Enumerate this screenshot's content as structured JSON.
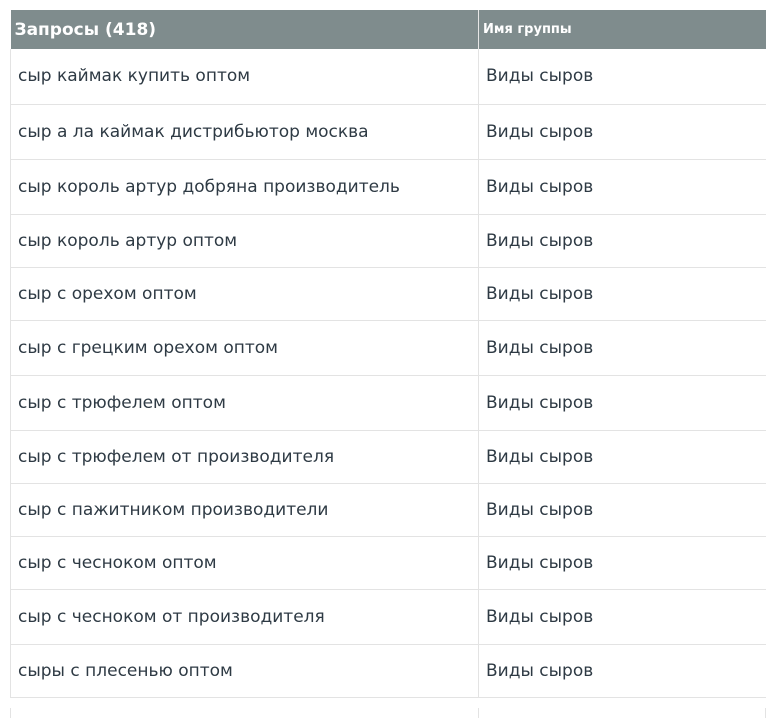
{
  "table": {
    "headers": {
      "query": "Запросы (418)",
      "group": "Имя группы"
    },
    "rows": [
      {
        "query": "сыр каймак купить оптом",
        "group": "Виды сыров"
      },
      {
        "query": "сыр а ла каймак дистрибьютор москва",
        "group": "Виды сыров"
      },
      {
        "query": "сыр король артур добряна производитель",
        "group": "Виды сыров"
      },
      {
        "query": "сыр король артур оптом",
        "group": "Виды сыров"
      },
      {
        "query": "сыр с орехом оптом",
        "group": "Виды сыров"
      },
      {
        "query": "сыр с грецким орехом оптом",
        "group": "Виды сыров"
      },
      {
        "query": "сыр с трюфелем оптом",
        "group": "Виды сыров"
      },
      {
        "query": "сыр с трюфелем от производителя",
        "group": "Виды сыров"
      },
      {
        "query": "сыр с пажитником производители",
        "group": "Виды сыров"
      },
      {
        "query": "сыр с чесноком оптом",
        "group": "Виды сыров"
      },
      {
        "query": "сыр с чесноком от производителя",
        "group": "Виды сыров"
      },
      {
        "query": "сыры с плесенью оптом",
        "group": "Виды сыров"
      }
    ]
  }
}
